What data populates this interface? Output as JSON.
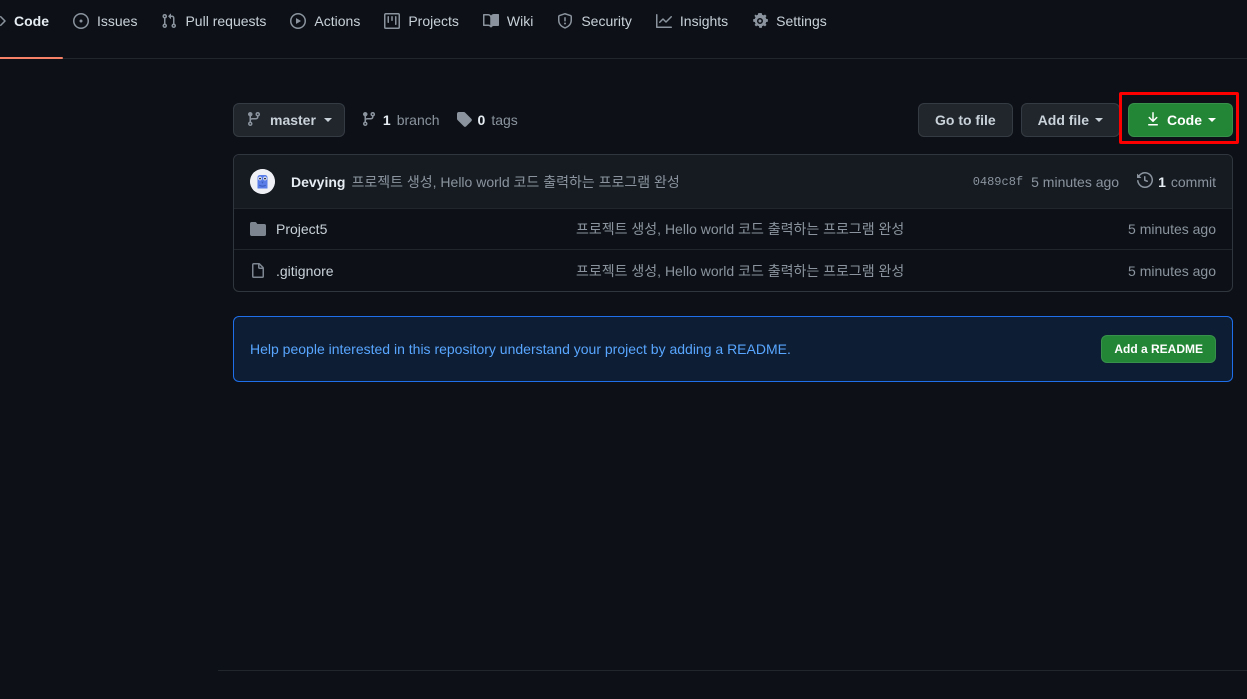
{
  "nav": {
    "tabs": [
      {
        "label": "Code",
        "icon": "code-icon",
        "selected": true
      },
      {
        "label": "Issues",
        "icon": "issue-opened-icon",
        "selected": false
      },
      {
        "label": "Pull requests",
        "icon": "git-pull-request-icon",
        "selected": false
      },
      {
        "label": "Actions",
        "icon": "play-icon",
        "selected": false
      },
      {
        "label": "Projects",
        "icon": "project-icon",
        "selected": false
      },
      {
        "label": "Wiki",
        "icon": "book-icon",
        "selected": false
      },
      {
        "label": "Security",
        "icon": "shield-icon",
        "selected": false
      },
      {
        "label": "Insights",
        "icon": "graph-icon",
        "selected": false
      },
      {
        "label": "Settings",
        "icon": "gear-icon",
        "selected": false
      }
    ],
    "active_underline_color": "#f78166"
  },
  "toolbar": {
    "branch_name": "master",
    "branch_count_num": "1",
    "branch_count_label": "branch",
    "tag_count_num": "0",
    "tag_count_label": "tags",
    "go_to_file_label": "Go to file",
    "add_file_label": "Add file",
    "code_label": "Code",
    "code_button_color": "#238636",
    "highlight_color": "#ff0000"
  },
  "commit_header": {
    "author": "Devying",
    "message": "프로젝트 생성, Hello world 코드 출력하는 프로그램 완성",
    "sha": "0489c8f",
    "time": "5 minutes ago",
    "commit_count_num": "1",
    "commit_count_label": "commit"
  },
  "files": [
    {
      "name": "Project5",
      "type": "directory",
      "icon": "folder-icon",
      "message": "프로젝트 생성, Hello world 코드 출력하는 프로그램 완성",
      "time": "5 minutes ago"
    },
    {
      "name": ".gitignore",
      "type": "file",
      "icon": "file-icon",
      "message": "프로젝트 생성, Hello world 코드 출력하는 프로그램 완성",
      "time": "5 minutes ago"
    }
  ],
  "readme_banner": {
    "text": "Help people interested in this repository understand your project by adding a README.",
    "button_label": "Add a README",
    "border_color": "#1f6feb",
    "background_color": "#0d1d33",
    "button_color": "#238636"
  }
}
